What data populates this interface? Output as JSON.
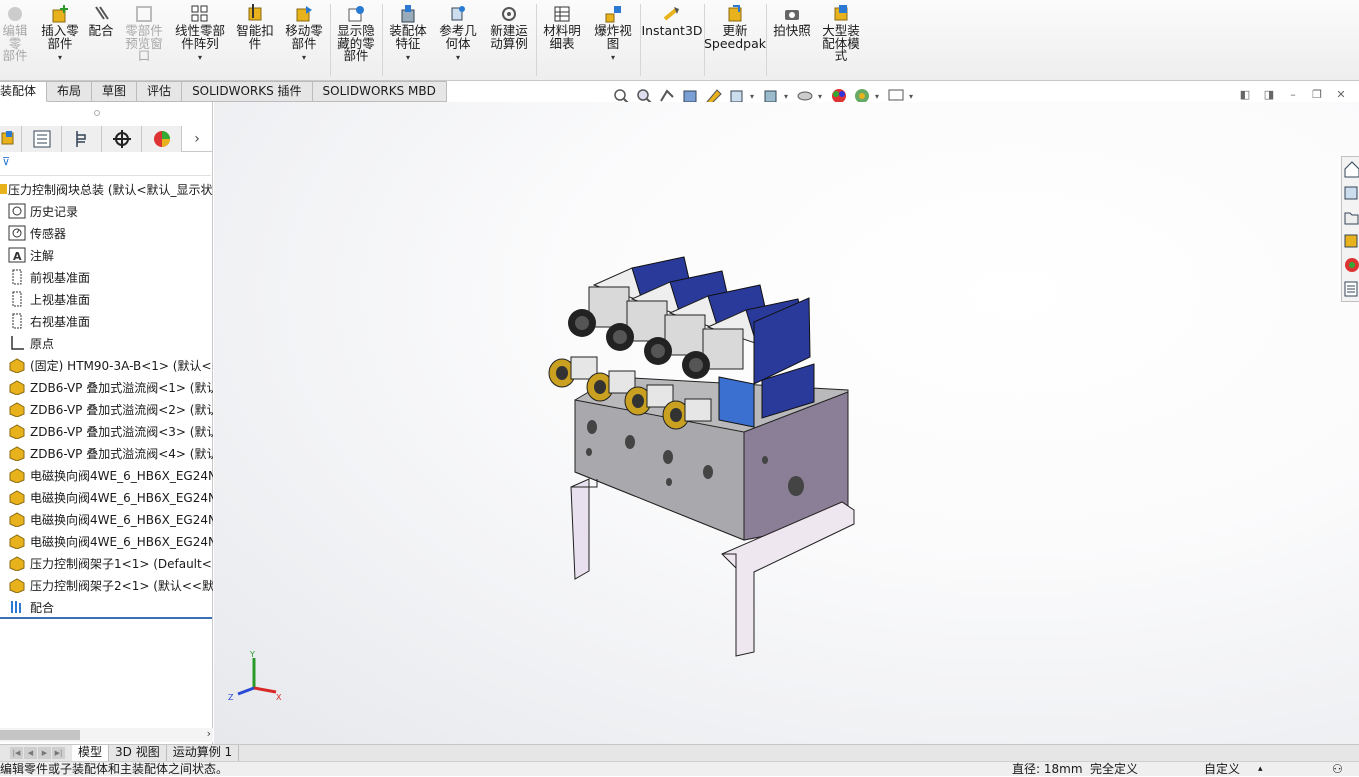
{
  "ribbon": {
    "buttons": [
      {
        "label": "编辑零\n部件",
        "icon": "edit-component-icon",
        "enabled": false
      },
      {
        "label": "插入零\n部件",
        "icon": "insert-component-icon",
        "enabled": true
      },
      {
        "label": "配合",
        "icon": "mate-icon",
        "enabled": true
      },
      {
        "label": "零部件\n预览窗\n口",
        "icon": "component-preview-icon",
        "enabled": false
      },
      {
        "label": "线性零部\n件阵列",
        "icon": "linear-pattern-icon",
        "enabled": true
      },
      {
        "label": "智能扣\n件",
        "icon": "smart-fastener-icon",
        "enabled": true
      },
      {
        "label": "移动零\n部件",
        "icon": "move-component-icon",
        "enabled": true
      },
      {
        "label": "显示隐\n藏的零\n部件",
        "icon": "show-hidden-icon",
        "enabled": true
      },
      {
        "label": "装配体\n特征",
        "icon": "assembly-feature-icon",
        "enabled": true
      },
      {
        "label": "参考几\n何体",
        "icon": "reference-geometry-icon",
        "enabled": true
      },
      {
        "label": "新建运\n动算例",
        "icon": "motion-study-icon",
        "enabled": true
      },
      {
        "label": "材料明\n细表",
        "icon": "bom-icon",
        "enabled": true
      },
      {
        "label": "爆炸视\n图",
        "icon": "exploded-view-icon",
        "enabled": true
      },
      {
        "label": "Instant3D",
        "icon": "instant3d-icon",
        "enabled": true
      },
      {
        "label": "更新\nSpeedpak",
        "icon": "speedpak-icon",
        "enabled": true
      },
      {
        "label": "拍快照",
        "icon": "snapshot-icon",
        "enabled": true
      },
      {
        "label": "大型装\n配体模\n式",
        "icon": "large-assembly-icon",
        "enabled": true
      }
    ]
  },
  "command_tabs": [
    "装配体",
    "布局",
    "草图",
    "评估",
    "SOLIDWORKS 插件",
    "SOLIDWORKS MBD"
  ],
  "feature_tree": {
    "root": "压力控制阀块总装 (默认<默认_显示状",
    "items": [
      {
        "label": "历史记录",
        "icon": "history-icon"
      },
      {
        "label": "传感器",
        "icon": "sensor-icon"
      },
      {
        "label": "注解",
        "icon": "annotation-icon"
      },
      {
        "label": "前视基准面",
        "icon": "plane-icon"
      },
      {
        "label": "上视基准面",
        "icon": "plane-icon"
      },
      {
        "label": "右视基准面",
        "icon": "plane-icon"
      },
      {
        "label": "原点",
        "icon": "origin-icon"
      },
      {
        "label": "(固定) HTM90-3A-B<1> (默认<<",
        "icon": "part-icon"
      },
      {
        "label": "ZDB6-VP 叠加式溢流阀<1> (默认",
        "icon": "part-icon"
      },
      {
        "label": "ZDB6-VP 叠加式溢流阀<2> (默认",
        "icon": "part-icon"
      },
      {
        "label": "ZDB6-VP 叠加式溢流阀<3> (默认",
        "icon": "part-icon"
      },
      {
        "label": "ZDB6-VP 叠加式溢流阀<4> (默认",
        "icon": "part-icon"
      },
      {
        "label": "电磁换向阀4WE_6_HB6X_EG24N",
        "icon": "part-icon"
      },
      {
        "label": "电磁换向阀4WE_6_HB6X_EG24N",
        "icon": "part-icon"
      },
      {
        "label": "电磁换向阀4WE_6_HB6X_EG24N",
        "icon": "part-icon"
      },
      {
        "label": "电磁换向阀4WE_6_HB6X_EG24N",
        "icon": "part-icon"
      },
      {
        "label": "压力控制阀架子1<1> (Default<<",
        "icon": "part-icon"
      },
      {
        "label": "压力控制阀架子2<1> (默认<<默",
        "icon": "part-icon"
      },
      {
        "label": "配合",
        "icon": "mates-icon"
      }
    ]
  },
  "bottom_tabs": [
    "模型",
    "3D 视图",
    "运动算例 1"
  ],
  "status": {
    "message": "编辑零件或子装配体和主装配体之间状态。",
    "diameter": "直径: 18mm",
    "definition": "完全定义",
    "units": "自定义"
  },
  "triad": {
    "x": "X",
    "y": "Y",
    "z": "Z"
  },
  "colors": {
    "accent": "#3b6fb6",
    "part_icon": "#e8b21d",
    "tab_active": "#ffffff"
  }
}
